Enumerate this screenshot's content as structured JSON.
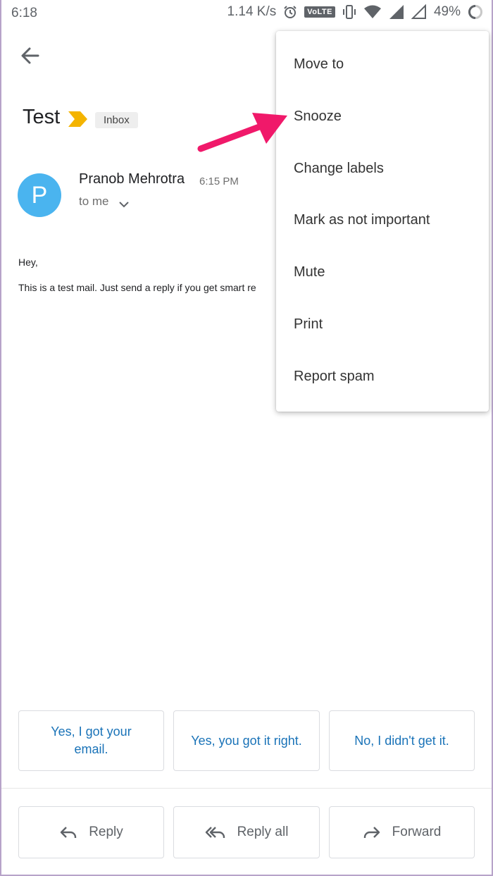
{
  "status_bar": {
    "time": "6:18",
    "network_speed": "1.14 K/s",
    "volte": "VoLTE",
    "battery": "49%",
    "icons": [
      "alarm-icon",
      "vibrate-icon",
      "wifi-icon",
      "signal-icon",
      "signal-icon",
      "battery-ring-icon"
    ]
  },
  "email": {
    "subject": "Test",
    "label": "Inbox",
    "sender_initial": "P",
    "sender_name": "Pranob Mehrotra",
    "time": "6:15 PM",
    "recipient": "to me",
    "body_greeting": "Hey,",
    "body_text": "This is a test mail. Just send a reply if you get smart re"
  },
  "menu": {
    "items": [
      "Move to",
      "Snooze",
      "Change labels",
      "Mark as not important",
      "Mute",
      "Print",
      "Report spam"
    ]
  },
  "smart_replies": {
    "one_line1": "Yes, I got your",
    "one_line2": "email.",
    "two": "Yes, you got it right.",
    "three": "No, I didn't get it."
  },
  "actions": {
    "reply": "Reply",
    "reply_all": "Reply all",
    "forward": "Forward"
  },
  "colors": {
    "accent_link": "#1a73b8",
    "avatar": "#4ab4ef",
    "important_marker": "#f4b400",
    "annotation_arrow": "#f0196a"
  }
}
